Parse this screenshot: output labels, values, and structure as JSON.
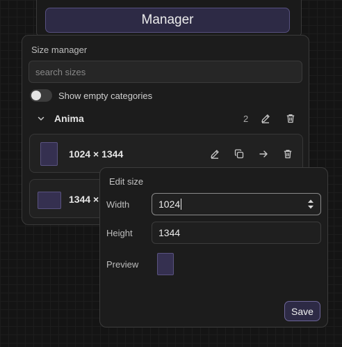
{
  "host": {
    "manager_label": "Manager"
  },
  "size_manager": {
    "title": "Size manager",
    "search_placeholder": "search sizes",
    "toggle_label": "Show empty categories",
    "category": {
      "name": "Anima",
      "count": "2"
    },
    "items": [
      {
        "label": "1024 × 1344"
      },
      {
        "label": "1344 ×"
      }
    ]
  },
  "edit_size": {
    "title": "Edit size",
    "width_label": "Width",
    "width_value": "1024",
    "height_label": "Height",
    "height_value": "1344",
    "preview_label": "Preview",
    "save_label": "Save"
  },
  "colors": {
    "accent_fill": "#2d2a45",
    "accent_border": "#575080",
    "background": "#141414",
    "panel": "#1c1c1c"
  },
  "icons": [
    "chevron-down-icon",
    "pencil-icon",
    "trash-icon",
    "copy-icon",
    "arrow-right-icon",
    "stepper-icon"
  ]
}
